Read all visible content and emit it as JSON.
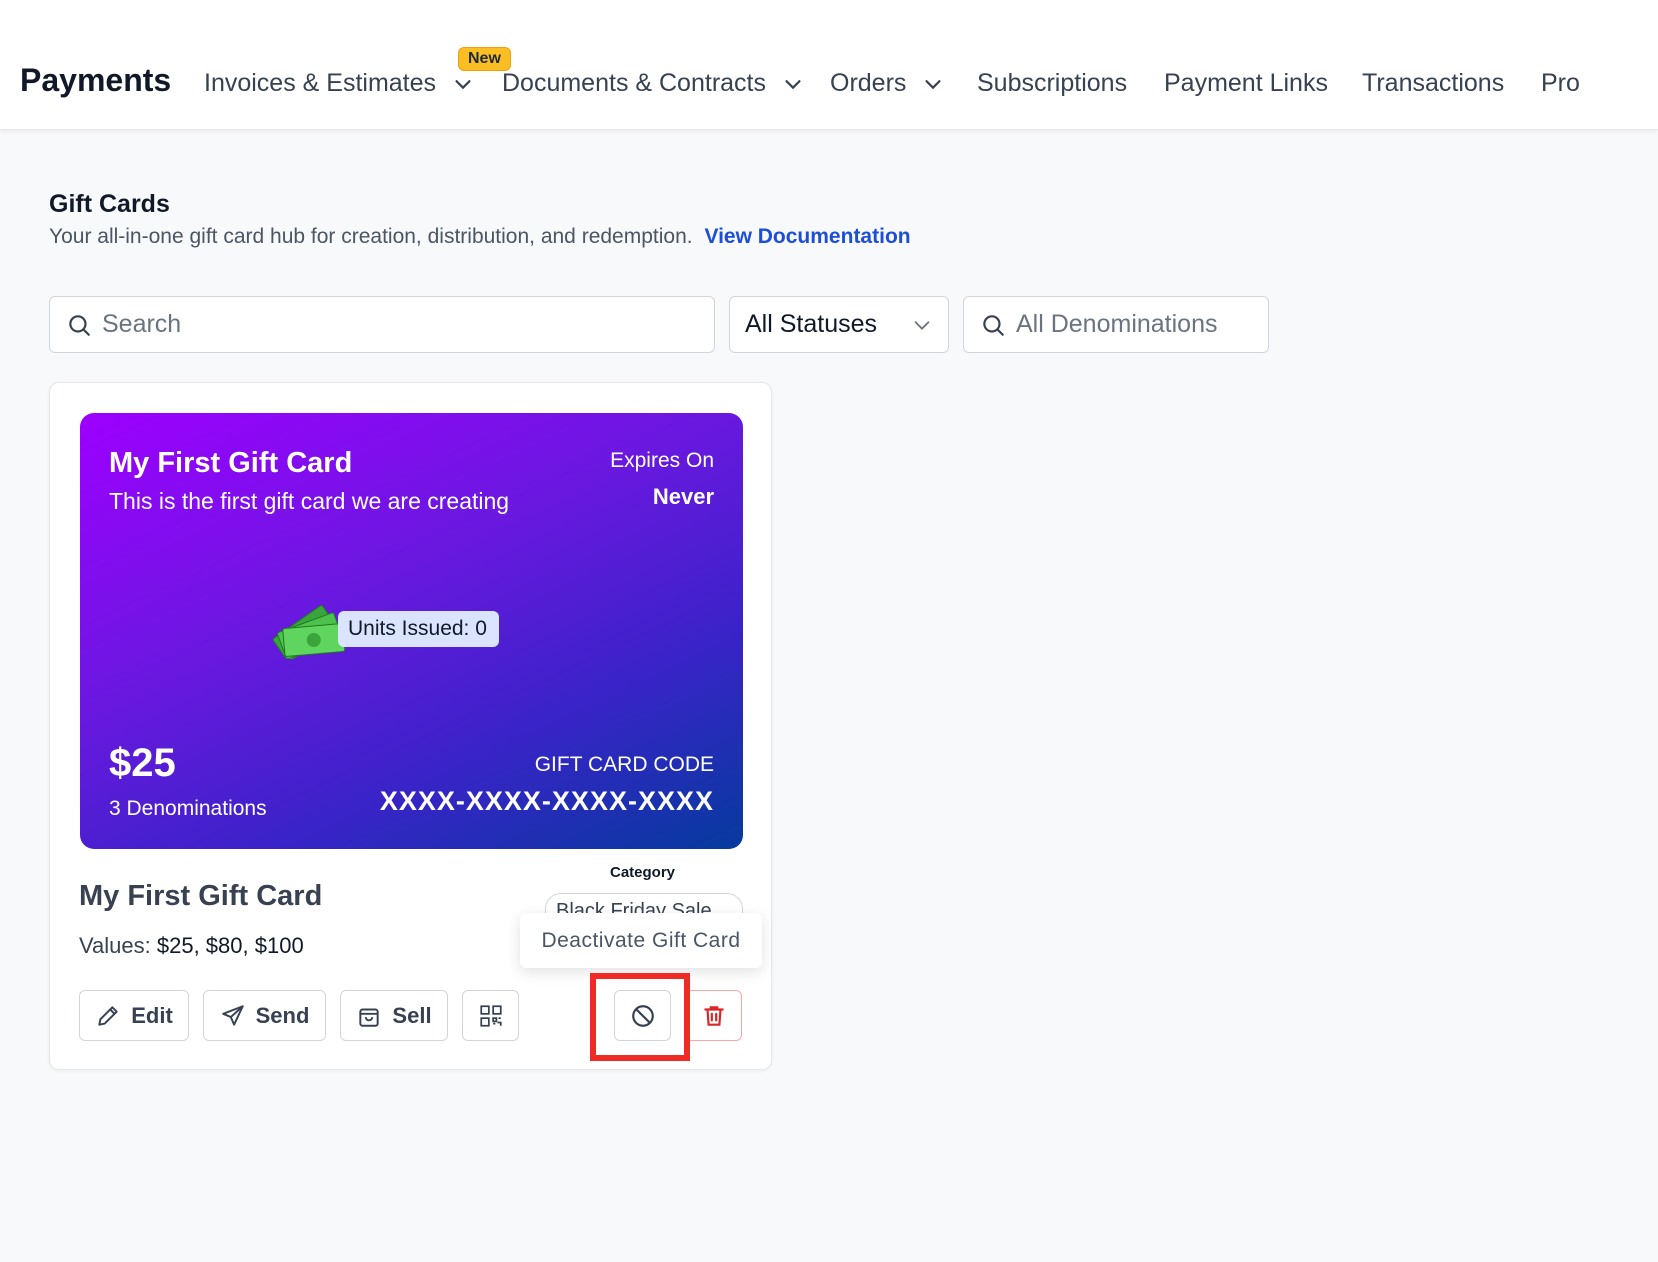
{
  "nav": {
    "app_title": "Payments",
    "new_badge": "New",
    "items": [
      {
        "label": "Invoices & Estimates",
        "dropdown": true
      },
      {
        "label": "Documents & Contracts",
        "dropdown": true
      },
      {
        "label": "Orders",
        "dropdown": true
      },
      {
        "label": "Subscriptions",
        "dropdown": false
      },
      {
        "label": "Payment Links",
        "dropdown": false
      },
      {
        "label": "Transactions",
        "dropdown": false
      },
      {
        "label": "Pro",
        "dropdown": false
      }
    ]
  },
  "header": {
    "title": "Gift Cards",
    "subtitle": "Your all-in-one gift card hub for creation, distribution, and redemption.",
    "doc_link": "View Documentation"
  },
  "filters": {
    "search_placeholder": "Search",
    "status_value": "All Statuses",
    "denom_placeholder": "All Denominations"
  },
  "gift_card": {
    "title": "My First Gift Card",
    "description": "This is the first gift card we are creating",
    "expires_label": "Expires On",
    "expires_value": "Never",
    "units_issued": "Units Issued: 0",
    "price": "$25",
    "denominations": "3 Denominations",
    "code_label": "GIFT CARD CODE",
    "code": "XXXX-XXXX-XXXX-XXXX",
    "gradient": [
      "#9d00ff",
      "#063a9e"
    ]
  },
  "card_info": {
    "name": "My First Gift Card",
    "values_label": "Values:",
    "values": "$25, $80, $100",
    "category_label": "Category",
    "category": "Black Friday Sale"
  },
  "actions": {
    "edit": "Edit",
    "send": "Send",
    "sell": "Sell",
    "qr_icon": "qr-code-icon",
    "deactivate_icon": "ban-icon",
    "delete_icon": "trash-icon"
  },
  "tooltip": "Deactivate Gift Card",
  "colors": {
    "link": "#1d4ed8",
    "highlight": "#ef2b25",
    "danger": "#dc2626"
  }
}
